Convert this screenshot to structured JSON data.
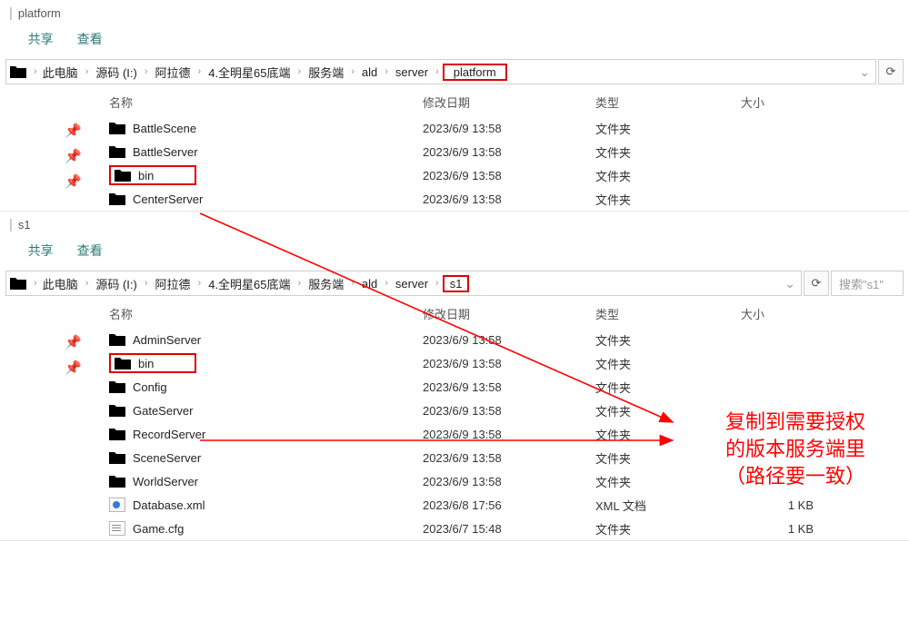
{
  "tabs": {
    "share": "共享",
    "view": "查看"
  },
  "cols": {
    "name": "名称",
    "date": "修改日期",
    "type": "类型",
    "size": "大小"
  },
  "win1": {
    "title": "platform",
    "crumbs": [
      "此电脑",
      "源码 (I:)",
      "阿拉德",
      "4.全明星65底端",
      "服务端",
      "ald",
      "server",
      "platform"
    ],
    "rows": [
      {
        "name": "BattleScene",
        "date": "2023/6/9 13:58",
        "type": "文件夹",
        "size": ""
      },
      {
        "name": "BattleServer",
        "date": "2023/6/9 13:58",
        "type": "文件夹",
        "size": ""
      },
      {
        "name": "bin",
        "date": "2023/6/9 13:58",
        "type": "文件夹",
        "size": ""
      },
      {
        "name": "CenterServer",
        "date": "2023/6/9 13:58",
        "type": "文件夹",
        "size": ""
      }
    ]
  },
  "win2": {
    "title": "s1",
    "crumbs": [
      "此电脑",
      "源码 (I:)",
      "阿拉德",
      "4.全明星65底端",
      "服务端",
      "ald",
      "server",
      "s1"
    ],
    "search_ph": "搜索\"s1\"",
    "rows": [
      {
        "name": "AdminServer",
        "date": "2023/6/9 13:58",
        "type": "文件夹",
        "size": "",
        "kind": "folder"
      },
      {
        "name": "bin",
        "date": "2023/6/9 13:58",
        "type": "文件夹",
        "size": "",
        "kind": "folder"
      },
      {
        "name": "Config",
        "date": "2023/6/9 13:58",
        "type": "文件夹",
        "size": "",
        "kind": "folder"
      },
      {
        "name": "GateServer",
        "date": "2023/6/9 13:58",
        "type": "文件夹",
        "size": "",
        "kind": "folder"
      },
      {
        "name": "RecordServer",
        "date": "2023/6/9 13:58",
        "type": "文件夹",
        "size": "",
        "kind": "folder"
      },
      {
        "name": "SceneServer",
        "date": "2023/6/9 13:58",
        "type": "文件夹",
        "size": "",
        "kind": "folder"
      },
      {
        "name": "WorldServer",
        "date": "2023/6/9 13:58",
        "type": "文件夹",
        "size": "",
        "kind": "folder"
      },
      {
        "name": "Database.xml",
        "date": "2023/6/8 17:56",
        "type": "XML 文档",
        "size": "1 KB",
        "kind": "xml"
      },
      {
        "name": "Game.cfg",
        "date": "2023/6/7 15:48",
        "type": "文件夹",
        "size": "1 KB",
        "kind": "cfg"
      }
    ]
  },
  "annotation": {
    "l1": "复制到需要授权",
    "l2": "的版本服务端里",
    "l3": "（路径要一致）"
  }
}
